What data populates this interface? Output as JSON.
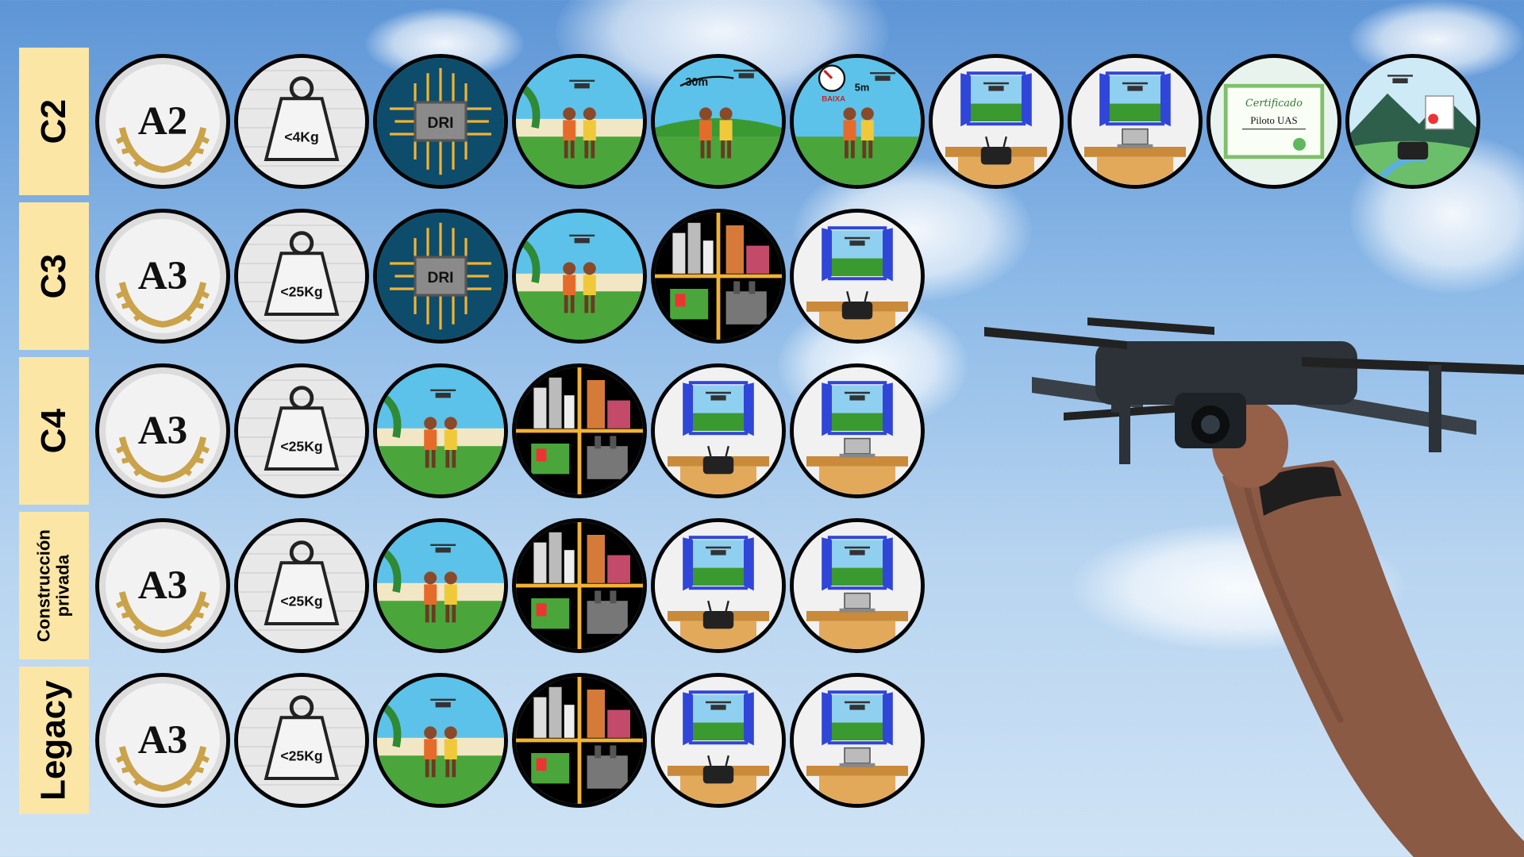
{
  "rows": [
    {
      "label": "C2",
      "icons": [
        "laurel-medal-A2-icon",
        "weight-under-4kg-icon",
        "dri-chip-icon",
        "people-drone-garden-icon",
        "distance-30m-people-icon",
        "low-speed-5m-people-icon",
        "training-window-controller-icon",
        "training-window-laptop-icon",
        "pilot-certificate-icon",
        "pilot-landscape-controller-icon"
      ],
      "medal_text": "A2",
      "weight_text": "<4Kg",
      "dri_text": "DRI",
      "distance_text": "30m",
      "speed_text": "BAIXA",
      "speed_distance_text": "5m",
      "cert_title": "Certificado",
      "cert_name": "Piloto UAS"
    },
    {
      "label": "C3",
      "icons": [
        "laurel-medal-A3-icon",
        "weight-under-25kg-icon",
        "dri-chip-icon",
        "people-drone-garden-icon",
        "city-zones-icon",
        "training-window-controller-icon"
      ],
      "medal_text": "A3",
      "weight_text": "<25Kg",
      "dri_text": "DRI"
    },
    {
      "label": "C4",
      "icons": [
        "laurel-medal-A3-icon",
        "weight-under-25kg-icon",
        "people-drone-garden-icon",
        "city-zones-icon",
        "training-window-controller-icon",
        "training-window-laptop-icon"
      ],
      "medal_text": "A3",
      "weight_text": "<25Kg"
    },
    {
      "label": "Construcción\nprivada",
      "icons": [
        "laurel-medal-A3-icon",
        "weight-under-25kg-icon",
        "people-drone-garden-icon",
        "city-zones-icon",
        "training-window-controller-icon",
        "training-window-laptop-icon"
      ],
      "medal_text": "A3",
      "weight_text": "<25Kg"
    },
    {
      "label": "Legacy",
      "icons": [
        "laurel-medal-A3-icon",
        "weight-under-25kg-icon",
        "people-drone-garden-icon",
        "city-zones-icon",
        "training-window-controller-icon",
        "training-window-laptop-icon"
      ],
      "medal_text": "A3",
      "weight_text": "<25Kg"
    }
  ],
  "colors": {
    "label_bg": "#fbe6a6",
    "sky_top": "#5d95d6",
    "sky_bottom": "#cfe3f5",
    "chip_blue": "#0d4d6b",
    "window_blue": "#3046d8"
  }
}
